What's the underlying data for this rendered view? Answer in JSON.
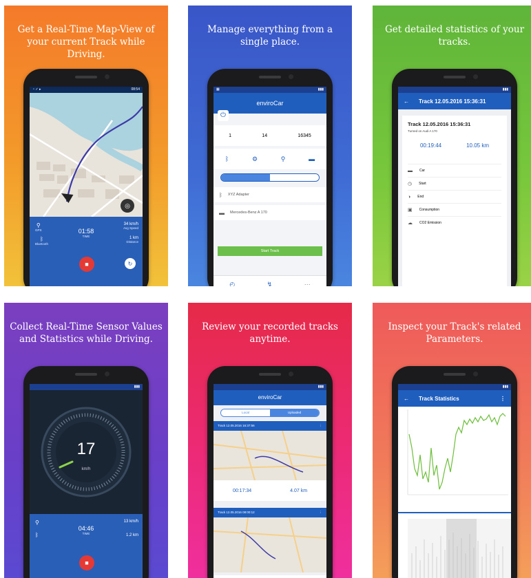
{
  "panels": [
    {
      "caption": "Get a Real-Time Map-View of your current Track while Driving.",
      "status_time": "08:54",
      "time_value": "01:58",
      "time_label": "TIME",
      "speed_value": "34 km/h",
      "speed_label": "Avg Speed",
      "distance_value": "1 km",
      "distance_label": "Distance",
      "gps_label": "GPS",
      "bt_label": "Bluetooth"
    },
    {
      "caption": "Manage everything from a single place.",
      "app_name": "enviroCar",
      "stat1": "1",
      "stat2": "14",
      "stat3": "16345",
      "icon_labels": [
        "Bluetooth",
        "OBD Adapter",
        "GPS",
        "Car"
      ],
      "device_name": "XYZ Adapter",
      "car_name": "Mercedes-Benz A 170",
      "start_button": "Start Track"
    },
    {
      "caption": "Get detailed statistics of your tracks.",
      "appbar_title": "Track 12.05.2016 15:36:31",
      "card_title": "Track 12.05.2016 15:36:31",
      "card_subtitle": "Turned on Audi A 170",
      "duration": "00:19:44",
      "distance": "10.05 km",
      "rows": [
        "Car",
        "Start",
        "End",
        "Consumption",
        "CO2 Emission"
      ]
    },
    {
      "caption": "Collect Real-Time Sensor Values and Statistics while Driving.",
      "speed": "17",
      "speed_unit": "km/h",
      "time_value": "04:46",
      "time_label": "TIME",
      "speed_stat": "13 km/h",
      "distance_stat": "1.2 km"
    },
    {
      "caption": "Review your recorded tracks anytime.",
      "app_name": "enviroCar",
      "tab_local": "Local",
      "tab_uploaded": "Uploaded",
      "track1_title": "Track 12.05.2016 16:37:56",
      "track1_duration": "00:17:34",
      "track1_distance": "4.07 km",
      "track2_title": "Track 12.05.2016 08:00:12"
    },
    {
      "caption": "Inspect your Track's related Parameters.",
      "appbar_title": "Track Statistics"
    }
  ],
  "colors": {
    "primary": "#1f5ebd",
    "green": "#4caf50",
    "red": "#e53935"
  }
}
